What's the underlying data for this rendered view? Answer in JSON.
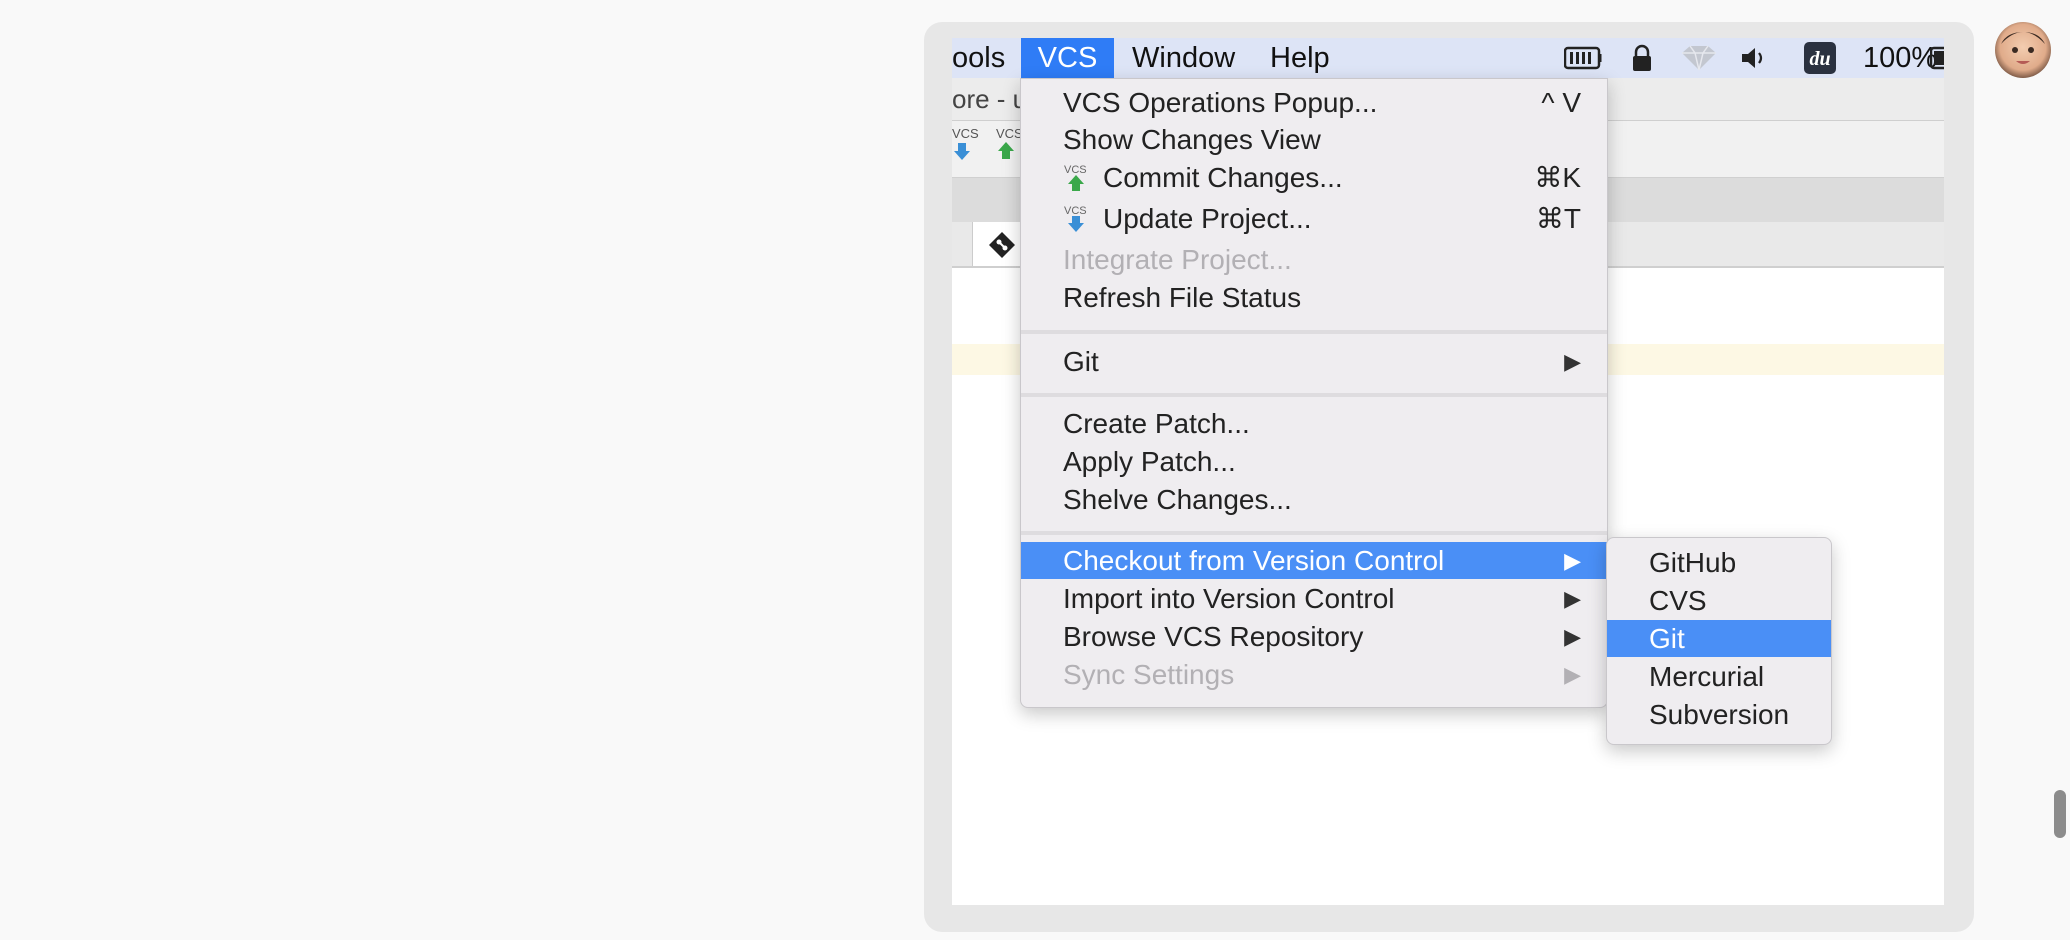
{
  "menubar": {
    "tools_fragment": "ools",
    "vcs": "VCS",
    "window": "Window",
    "help": "Help",
    "battery_percent": "100%"
  },
  "window": {
    "title_fragment": "ore - u",
    "toolbar_vcs_label": "VCS"
  },
  "vcs_menu": {
    "items": [
      {
        "label": "VCS Operations Popup...",
        "shortcut": "^ V"
      },
      {
        "label": "Show Changes View"
      },
      {
        "label": "Commit Changes...",
        "shortcut": "⌘K",
        "icon": "vcs-commit-icon"
      },
      {
        "label": "Update Project...",
        "shortcut": "⌘T",
        "icon": "vcs-update-icon"
      },
      {
        "label": "Integrate Project...",
        "disabled": true
      },
      {
        "label": "Refresh File Status"
      },
      {
        "label": "Git",
        "submenu": true
      },
      {
        "label": "Create Patch..."
      },
      {
        "label": "Apply Patch..."
      },
      {
        "label": "Shelve Changes..."
      },
      {
        "label": "Checkout from Version Control",
        "submenu": true,
        "selected": true
      },
      {
        "label": "Import into Version Control",
        "submenu": true
      },
      {
        "label": "Browse VCS Repository",
        "submenu": true
      },
      {
        "label": "Sync Settings",
        "submenu": true,
        "disabled": true
      }
    ],
    "submenu_arrow": "▶"
  },
  "checkout_submenu": {
    "items": [
      "GitHub",
      "CVS",
      "Git",
      "Mercurial",
      "Subversion"
    ],
    "selected": "Git"
  },
  "colors": {
    "selection": "#4a8ff6",
    "menubar_active": "#2f7cf6",
    "menu_bg": "#efedf0"
  }
}
